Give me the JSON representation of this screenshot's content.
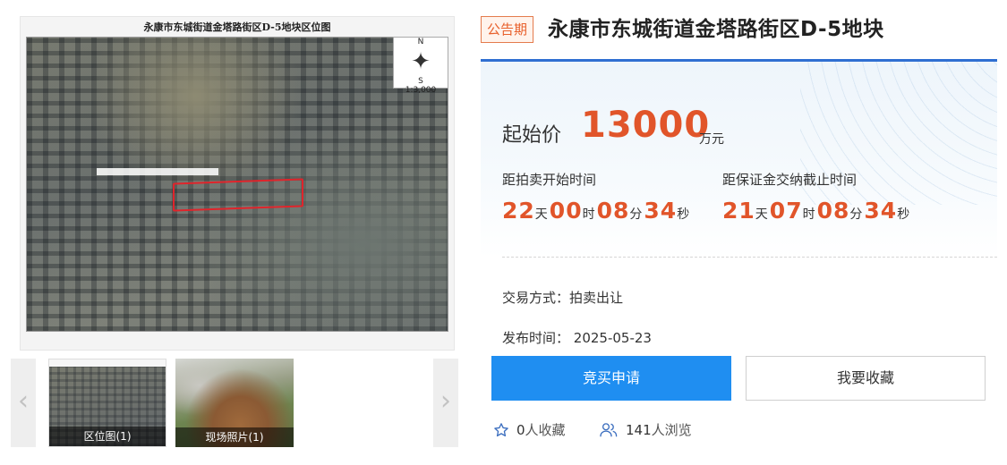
{
  "gallery": {
    "map_title": "永康市东城街道金塔路街区D-5地块区位图",
    "scale_label": "1:3,000",
    "compass_north": "N",
    "compass_south": "S",
    "thumbnails": [
      {
        "caption": "区位图(1)"
      },
      {
        "caption": "现场照片(1)"
      }
    ]
  },
  "header": {
    "status_badge": "公告期",
    "title": "永康市东城街道金塔路街区D-5地块"
  },
  "price": {
    "label": "起始价",
    "value": "13000",
    "unit": "万元"
  },
  "countdowns": [
    {
      "label": "距拍卖开始时间",
      "days": "22",
      "hours": "00",
      "minutes": "08",
      "seconds": "34"
    },
    {
      "label": "距保证金交纳截止时间",
      "days": "21",
      "hours": "07",
      "minutes": "08",
      "seconds": "34"
    }
  ],
  "units": {
    "day": "天",
    "hour": "时",
    "minute": "分",
    "second": "秒"
  },
  "details": {
    "trade_method_label": "交易方式：",
    "trade_method_value": "拍卖出让",
    "publish_time_label": "发布时间：",
    "publish_time_value": "2025-05-23"
  },
  "actions": {
    "apply_label": "竞买申请",
    "favorite_label": "我要收藏"
  },
  "stats": {
    "favorites": "0",
    "favorites_suffix": "人收藏",
    "views": "141",
    "views_suffix": "人浏览"
  },
  "colors": {
    "accent_orange": "#e1552a",
    "primary_blue": "#1f8ef1",
    "panel_border_blue": "#2f6fd2"
  },
  "icons": [
    "compass-icon",
    "chevron-left-icon",
    "chevron-right-icon",
    "star-icon",
    "users-icon"
  ]
}
